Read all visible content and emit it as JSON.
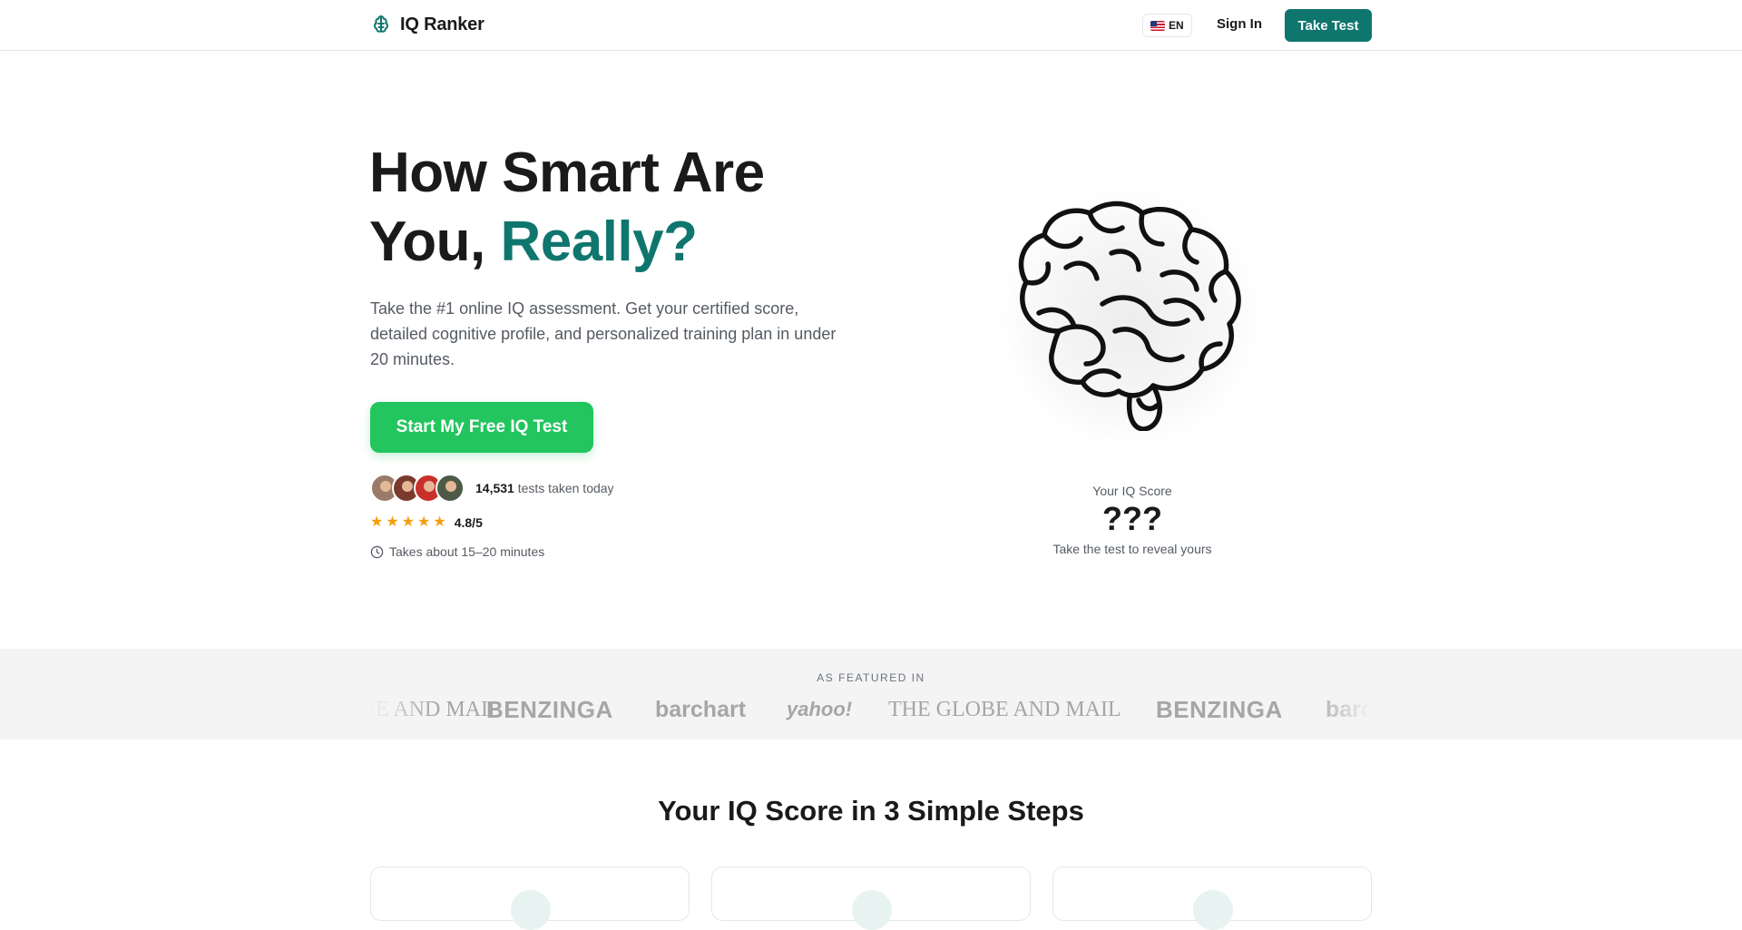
{
  "header": {
    "brand": "IQ Ranker",
    "language": "EN",
    "signin_label": "Sign In",
    "take_test_label": "Take Test"
  },
  "hero": {
    "title_line1": "How Smart Are",
    "title_line2_plain": "You, ",
    "title_line2_accent": "Really?",
    "subtitle": "Take the #1 online IQ assessment. Get your certified score, detailed cognitive profile, and personalized training plan in under 20 minutes.",
    "cta_label": "Start My Free IQ Test",
    "tests_count": "14,531",
    "tests_suffix": " tests taken today",
    "rating": "4.8/5",
    "stars": 5,
    "duration": "Takes about 15–20 minutes",
    "score_label": "Your IQ Score",
    "score_value": "???",
    "score_hint": "Take the test to reveal yours"
  },
  "featured": {
    "label": "AS FEATURED IN",
    "logos": [
      "THE GLOBE AND MAIL",
      "BENZINGA",
      "barchart",
      "yahoo!",
      "THE GLOBE AND MAIL",
      "BENZINGA",
      "barchart"
    ]
  },
  "steps": {
    "title": "Your IQ Score in 3 Simple Steps"
  },
  "colors": {
    "brand": "#0f766e",
    "cta": "#22c55e",
    "star": "#f59e0b"
  },
  "icons": [
    "brain-icon",
    "flag-us-icon",
    "star-icon",
    "clock-icon"
  ]
}
